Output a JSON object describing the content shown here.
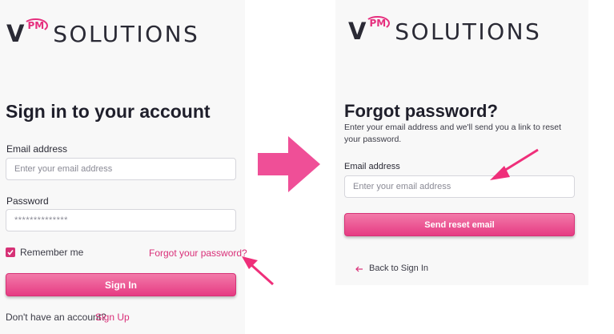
{
  "logo": {
    "v": "V",
    "pm": "PM",
    "word": "SOLUTIONS"
  },
  "signin": {
    "title": "Sign in to your account",
    "email_label": "Email address",
    "email_placeholder": "Enter your email address",
    "password_label": "Password",
    "password_value": "**************",
    "remember_label": "Remember me",
    "forgot_link": "Forgot your password?",
    "button": "Sign In",
    "no_account_text": "Don't have an account?",
    "signup_link": "Sign Up"
  },
  "forgot": {
    "title": "Forgot password?",
    "description_line1": "Enter your email address and we'll send you a link to reset",
    "description_line2": "your password.",
    "email_label": "Email address",
    "email_placeholder": "Enter your email address",
    "button": "Send reset email",
    "back_link": "Back to Sign In"
  },
  "colors": {
    "accent": "#e63b83",
    "arrow": "#ef4f97"
  }
}
